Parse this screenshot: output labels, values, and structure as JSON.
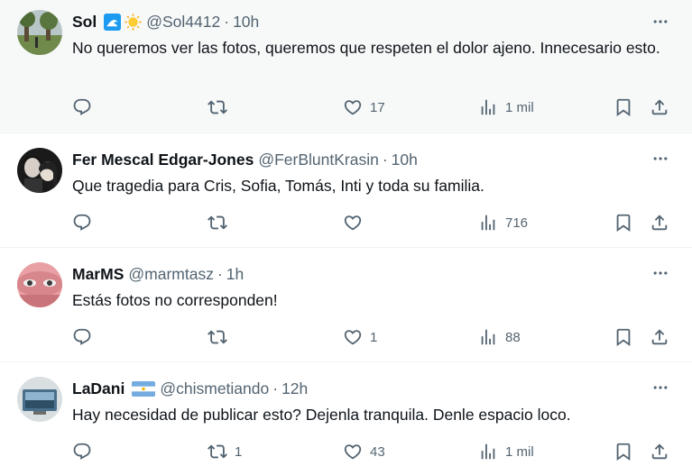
{
  "tweets": [
    {
      "name": "Sol",
      "emojis": [
        "wave-emoji",
        "sun-emoji"
      ],
      "handle": "@Sol4412",
      "dot": "·",
      "time": "10h",
      "text": "No queremos ver las fotos, queremos que respeten el dolor ajeno. Innecesario esto.",
      "replies": "",
      "retweets": "",
      "likes": "17",
      "views": "1 mil"
    },
    {
      "name": "Fer Mescal Edgar-Jones",
      "handle": "@FerBluntKrasin",
      "dot": "·",
      "time": "10h",
      "text": "Que tragedia para Cris, Sofia, Tomás, Inti y toda su familia.",
      "replies": "",
      "retweets": "",
      "likes": "",
      "views": "716"
    },
    {
      "name": "MarMS",
      "handle": "@marmtasz",
      "dot": "·",
      "time": "1h",
      "text": "Estás fotos no corresponden!",
      "replies": "",
      "retweets": "",
      "likes": "1",
      "views": "88"
    },
    {
      "name": "LaDani",
      "emojis": [
        "argentina-flag-emoji"
      ],
      "handle": "@chismetiando",
      "dot": "·",
      "time": "12h",
      "text": "Hay necesidad de publicar esto? Dejenla tranquila. Denle espacio loco.",
      "replies": "",
      "retweets": "1",
      "likes": "43",
      "views": "1 mil"
    }
  ],
  "colors": {
    "text": "#0f1419",
    "secondary": "#536471",
    "highlight_bg": "#f7f9f9",
    "divider": "#eff3f4"
  },
  "icons": [
    "reply-icon",
    "retweet-icon",
    "like-icon",
    "views-icon",
    "bookmark-icon",
    "share-icon",
    "more-icon"
  ]
}
